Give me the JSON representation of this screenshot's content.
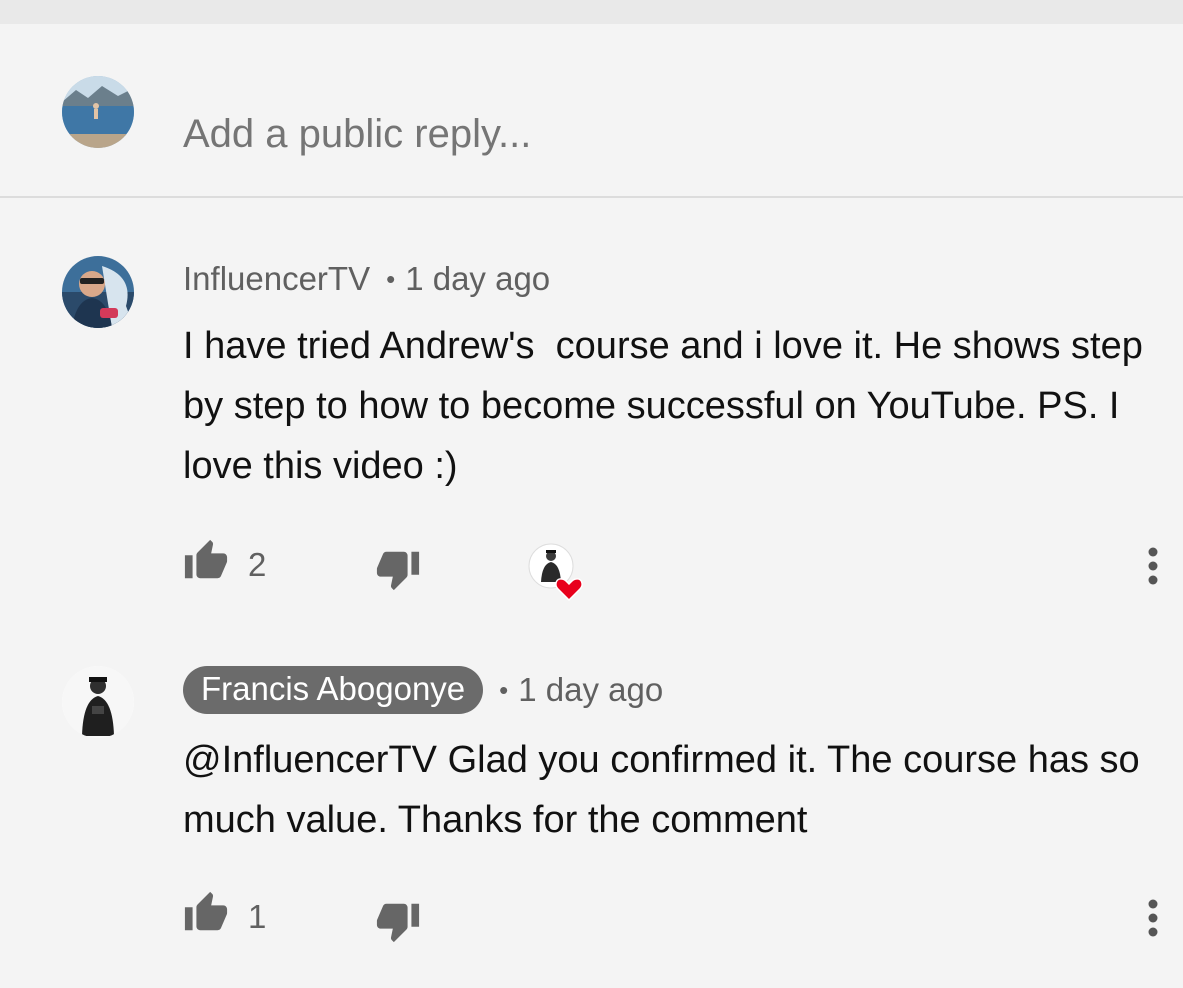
{
  "reply_box": {
    "placeholder": "Add a public reply..."
  },
  "comments": [
    {
      "author": "InfluencerTV",
      "separator": "•",
      "time": "1 day ago",
      "text": "I have tried Andrew's  course and i love it. He shows step by step to how to become successful on YouTube. PS. I love this video :)",
      "likes": "2",
      "hearted_by_creator": true
    },
    {
      "author": "Francis Abogonye",
      "author_is_creator": true,
      "separator": "•",
      "time": "1 day ago",
      "text": "@InfluencerTV Glad you confirmed it. The course has so much value. Thanks for the comment",
      "likes": "1"
    }
  ],
  "colors": {
    "background": "#f4f4f4",
    "heart": "#e8001c",
    "chip": "#6b6b6b",
    "icon": "#666666"
  },
  "icons": [
    "like-icon",
    "dislike-icon",
    "creator-heart-icon",
    "more-vert-icon"
  ]
}
